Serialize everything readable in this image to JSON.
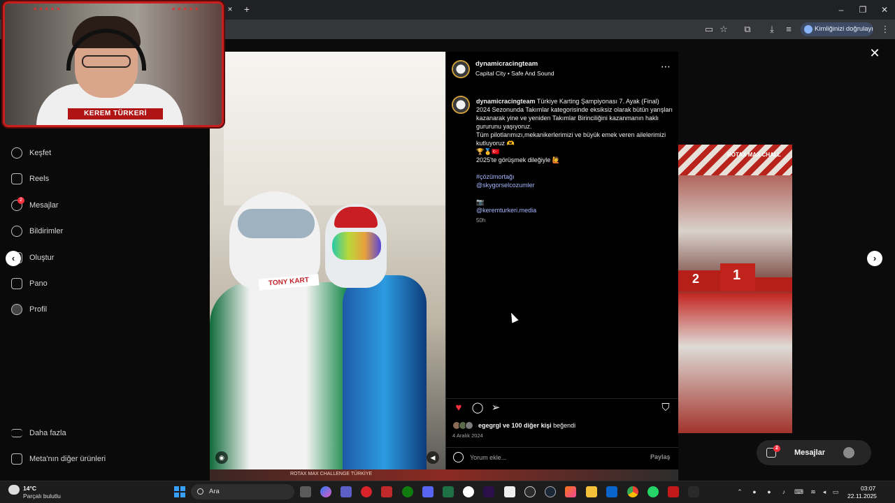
{
  "browser": {
    "verify_label": "Kimliğinizi doğrulayın",
    "new_tab_symbol": "+",
    "close_tab_symbol": "×"
  },
  "webcam": {
    "name_plate": "KEREM TÜRKERİ"
  },
  "sidebar": {
    "items": [
      {
        "label": "Keşfet",
        "icon": "compass-icon"
      },
      {
        "label": "Reels",
        "icon": "reels-icon"
      },
      {
        "label": "Mesajlar",
        "icon": "messenger-icon",
        "badge": "2"
      },
      {
        "label": "Bildirimler",
        "icon": "heart-icon"
      },
      {
        "label": "Oluştur",
        "icon": "plus-square-icon"
      },
      {
        "label": "Pano",
        "icon": "dashboard-icon"
      },
      {
        "label": "Profil",
        "icon": "avatar-icon"
      }
    ],
    "more_label": "Daha fazla",
    "meta_label": "Meta'nın diğer ürünleri"
  },
  "post": {
    "username": "dynamicracingteam",
    "music": "Capital City • Safe And Sound",
    "image_text": "TONY KART",
    "caption": {
      "username": "dynamicracingteam",
      "text": "Türkiye Karting Şampiyonası 7. Ayak (Final) 2024 Sezonunda Takımlar kategorisinde eksiksiz olarak bütün yarışları kazanarak yine ve yeniden Takımlar Birinciliğini kazanmanın haklı gururunu yaşıyoruz.",
      "line2": "Tüm pilotlarımızı,mekanikerlerimizi ve büyük emek veren ailelerimizi kutluyoruz 🫶",
      "line3": "🏆🥇🇹🇷",
      "line4": "2025'te görüşmek dileğiyle 🙋",
      "hashtag": "#çözümortağı",
      "mention1": "@skygorselcozumler",
      "camera": "📷",
      "mention2": "@keremturkeri.media",
      "age": "50h"
    },
    "likes_user": "egegrgl",
    "likes_rest": "ve 100 diğer kişi",
    "likes_suffix": "beğendi",
    "date": "4 Aralık 2024",
    "comment_placeholder": "Yorum ekle...",
    "share_label": "Paylaş"
  },
  "next_preview": {
    "label": "ROTAX MAX CHALL",
    "podium_1": "1",
    "podium_2": "2"
  },
  "bottom_strip": {
    "text": "ROTAX MAX CHALLENGE TÜRKİYE"
  },
  "messages_pill": {
    "label": "Mesajlar",
    "badge": "2"
  },
  "taskbar": {
    "temperature": "14°C",
    "weather": "Parçalı bulutlu",
    "search_label": "Ara",
    "time": "03:07",
    "date": "22.11.2025"
  },
  "colors": {
    "like_red": "#ff3040",
    "link_blue": "#a5b7ff",
    "webcam_red": "#c81e1e"
  }
}
